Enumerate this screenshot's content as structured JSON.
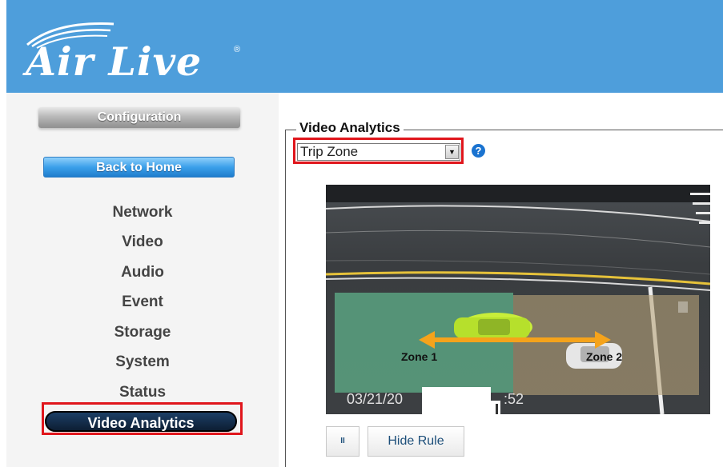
{
  "header": {
    "logo_text": "Air Live",
    "logo_registered": "®"
  },
  "sidebar": {
    "config_label": "Configuration",
    "home_label": "Back to Home",
    "items": [
      {
        "label": "Network"
      },
      {
        "label": "Video"
      },
      {
        "label": "Audio"
      },
      {
        "label": "Event"
      },
      {
        "label": "Storage"
      },
      {
        "label": "System"
      },
      {
        "label": "Status"
      }
    ],
    "active_label": "Video Analytics"
  },
  "main": {
    "legend": "Video Analytics",
    "mode_select": {
      "value": "Trip Zone",
      "arrow": "▼"
    },
    "help_glyph": "?",
    "video": {
      "zone1_label": "Zone 1",
      "zone2_label": "Zone 2",
      "timestamp_left": "03/21/20",
      "timestamp_right": ":52"
    },
    "pause_glyph": "II",
    "hide_rule_label": "Hide Rule"
  },
  "colors": {
    "header_bg": "#4e9edb",
    "highlight_red": "#e0161c",
    "zone1_fill": "#5fb08a",
    "zone2_fill": "#b8a37a",
    "arrow_orange": "#f5a31b"
  },
  "icons": {
    "help": "help-icon",
    "pause": "pause-icon",
    "dropdown": "chevron-down-icon"
  }
}
